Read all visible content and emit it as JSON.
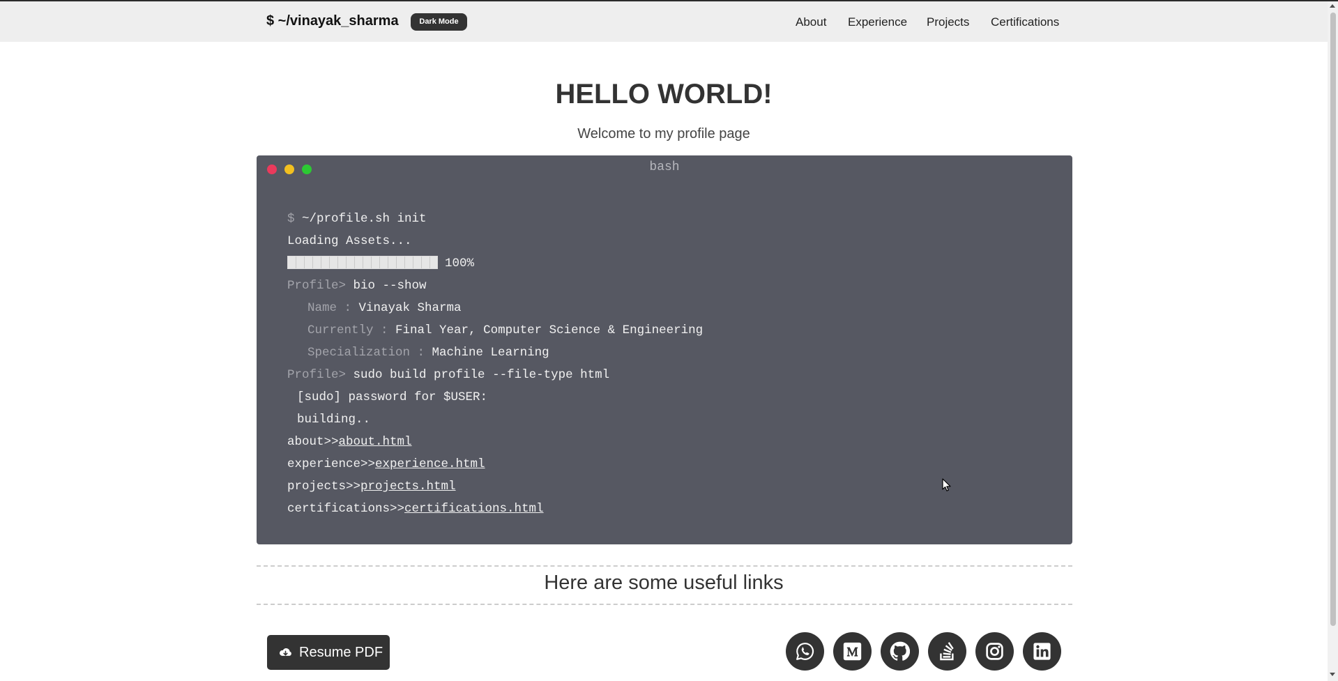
{
  "navbar": {
    "brand": "$ ~/vinayak_sharma",
    "dark_mode_label": "Dark Mode",
    "links": [
      "About",
      "Experience",
      "Projects",
      "Certifications"
    ]
  },
  "hero": {
    "title": "HELLO WORLD!",
    "subtitle": "Welcome to my profile page"
  },
  "terminal": {
    "title": "bash",
    "prompt_symbol": "$",
    "init_command": "~/profile.sh init",
    "loading": "Loading Assets...",
    "progress_text": "100%",
    "progress_value": 1.0,
    "profile_prompt": "Profile>",
    "bio_command": "bio --show",
    "bio": [
      {
        "key": "Name :",
        "value": "Vinayak Sharma"
      },
      {
        "key": "Currently :",
        "value": "Final Year, Computer Science & Engineering"
      },
      {
        "key": "Specialization :",
        "value": "Machine Learning"
      }
    ],
    "build_command": "sudo build profile --file-type html",
    "sudo_line": "[sudo] password for $USER:",
    "building_line": "building..",
    "outputs": [
      {
        "prefix": "about>>",
        "link": "about.html"
      },
      {
        "prefix": "experience>>",
        "link": "experience.html"
      },
      {
        "prefix": "projects>>",
        "link": "projects.html"
      },
      {
        "prefix": "certifications>>",
        "link": "certifications.html"
      }
    ],
    "dot_colors": {
      "close": "#ea3a5c",
      "minimize": "#f2c020",
      "maximize": "#2cc933"
    }
  },
  "links_section": {
    "heading": "Here are some useful links",
    "resume_label": "Resume PDF",
    "resume_icon": "cloud-download-icon",
    "socials": [
      "whatsapp-icon",
      "medium-icon",
      "github-icon",
      "stackoverflow-icon",
      "instagram-icon",
      "linkedin-icon"
    ]
  }
}
